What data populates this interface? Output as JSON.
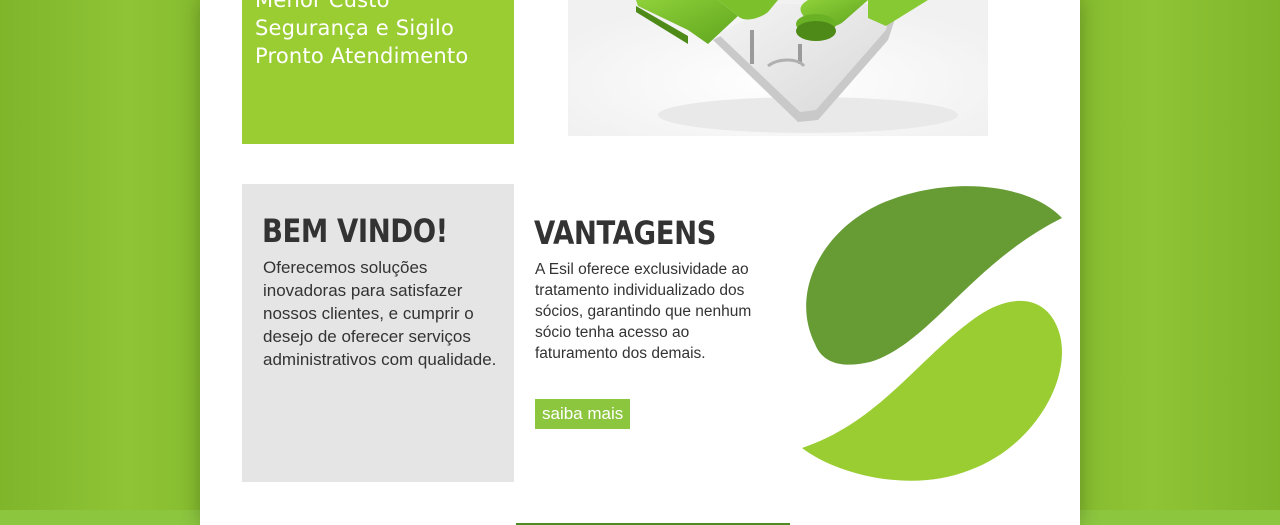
{
  "hero": {
    "features": [
      "Menor Custo",
      "Segurança e Sigilo",
      "Pronto Atendimento"
    ]
  },
  "welcome": {
    "title": "BEM VINDO!",
    "text": "Oferecemos soluções inovadoras para satisfazer nossos clientes, e cumprir o desejo de oferecer serviços administrativos com qualidade."
  },
  "advantages": {
    "title": "VANTAGENS",
    "text": "A Esil oferece exclusividade ao tratamento individualizado dos sócios, garantindo que nenhum sócio tenha acesso ao faturamento dos demais.",
    "button_label": "saiba mais"
  },
  "colors": {
    "brand_green": "#8cc63f",
    "dark_green": "#679c35",
    "light_green": "#9acd32",
    "text": "#333333"
  },
  "icons": {
    "hero_image": "puzzle-pieces-image",
    "logo": "leaf-s-logo"
  }
}
